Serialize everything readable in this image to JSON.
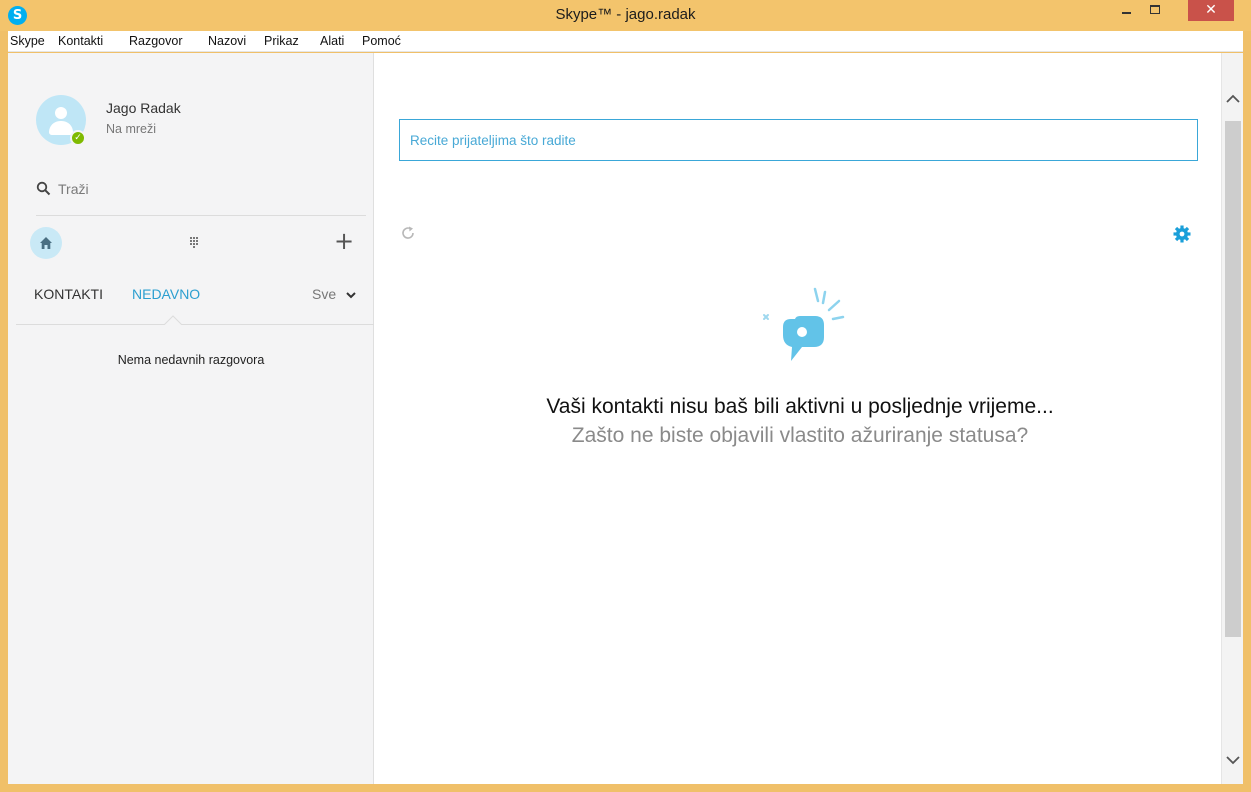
{
  "window": {
    "title": "Skype™ - jago.radak",
    "app_icon_letter": "S",
    "close_glyph": "✕",
    "accent_color": "#00aff0",
    "frame_color": "#f3c46c"
  },
  "menu": {
    "items": [
      "Skype",
      "Kontakti",
      "Razgovor",
      "Nazovi",
      "Prikaz",
      "Alati",
      "Pomoć"
    ]
  },
  "profile": {
    "name": "Jago Radak",
    "status": "Na mreži",
    "status_color": "#7fba00",
    "presence_glyph": "✓"
  },
  "search": {
    "placeholder": "Traži"
  },
  "toolbar": {
    "add_glyph": "+"
  },
  "tabs": {
    "contacts": "KONTAKTI",
    "recent": "NEDAVNO",
    "filter": "Sve"
  },
  "recent": {
    "empty_message": "Nema nedavnih razgovora"
  },
  "main": {
    "mood_placeholder": "Recite prijateljima što radite",
    "empty_title": "Vaši kontakti nisu baš bili aktivni u posljednje vrijeme...",
    "empty_subtitle": "Zašto ne biste objavili vlastito ažuriranje statusa?"
  },
  "icons": {
    "app": "skype-logo-icon",
    "search": "search-icon",
    "home": "home-icon",
    "dialpad": "dialpad-icon",
    "add": "plus-icon",
    "filter": "chevron-down-icon",
    "refresh": "refresh-icon",
    "settings": "gear-icon",
    "illustration": "chat-bubble-sparkle-icon"
  }
}
